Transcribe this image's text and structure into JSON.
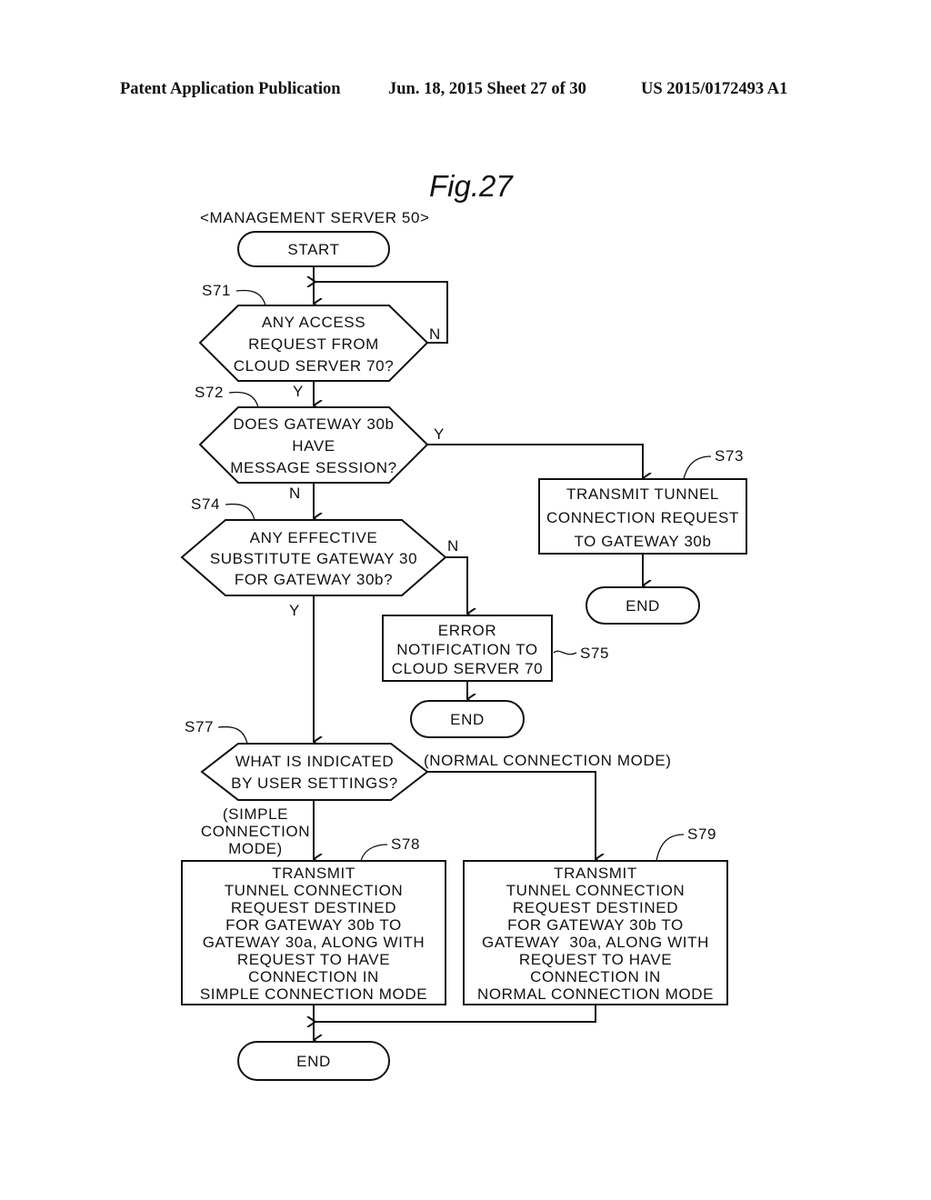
{
  "header": {
    "left": "Patent Application Publication",
    "center": "Jun. 18, 2015  Sheet 27 of 30",
    "right": "US 2015/0172493 A1"
  },
  "figure": {
    "title": "Fig.27",
    "subtitle": "<MANAGEMENT SERVER 50>"
  },
  "nodes": {
    "start": {
      "label": "START"
    },
    "s71": {
      "ref": "S71",
      "lines": [
        "ANY ACCESS",
        "REQUEST FROM",
        "CLOUD SERVER 70?"
      ],
      "yes": "Y",
      "no": "N"
    },
    "s72": {
      "ref": "S72",
      "lines": [
        "DOES GATEWAY 30b",
        "HAVE",
        "MESSAGE SESSION?"
      ],
      "yes": "Y",
      "no": "N"
    },
    "s73": {
      "ref": "S73",
      "lines": [
        "TRANSMIT TUNNEL",
        "CONNECTION REQUEST",
        "TO GATEWAY 30b"
      ]
    },
    "end1": {
      "label": "END"
    },
    "s74": {
      "ref": "S74",
      "lines": [
        "ANY EFFECTIVE",
        "SUBSTITUTE GATEWAY 30",
        "FOR GATEWAY 30b?"
      ],
      "yes": "Y",
      "no": "N"
    },
    "s75": {
      "ref": "S75",
      "lines": [
        "ERROR",
        "NOTIFICATION TO",
        "CLOUD SERVER 70"
      ]
    },
    "end2": {
      "label": "END"
    },
    "s77": {
      "ref": "S77",
      "lines": [
        "WHAT IS INDICATED",
        "BY USER SETTINGS?"
      ],
      "branch_right": "(NORMAL CONNECTION MODE)",
      "branch_down": [
        "(SIMPLE",
        "CONNECTION",
        "MODE)"
      ]
    },
    "s78": {
      "ref": "S78",
      "lines": [
        "TRANSMIT",
        "TUNNEL CONNECTION",
        "REQUEST DESTINED",
        "FOR GATEWAY 30b TO",
        "GATEWAY 30a, ALONG WITH",
        "REQUEST TO HAVE",
        "CONNECTION IN",
        "SIMPLE CONNECTION MODE"
      ]
    },
    "s79": {
      "ref": "S79",
      "lines": [
        "TRANSMIT",
        "TUNNEL CONNECTION",
        "REQUEST DESTINED",
        "FOR GATEWAY 30b TO",
        "GATEWAY  30a, ALONG WITH",
        "REQUEST TO HAVE",
        "CONNECTION IN",
        "NORMAL CONNECTION MODE"
      ]
    },
    "end3": {
      "label": "END"
    }
  }
}
